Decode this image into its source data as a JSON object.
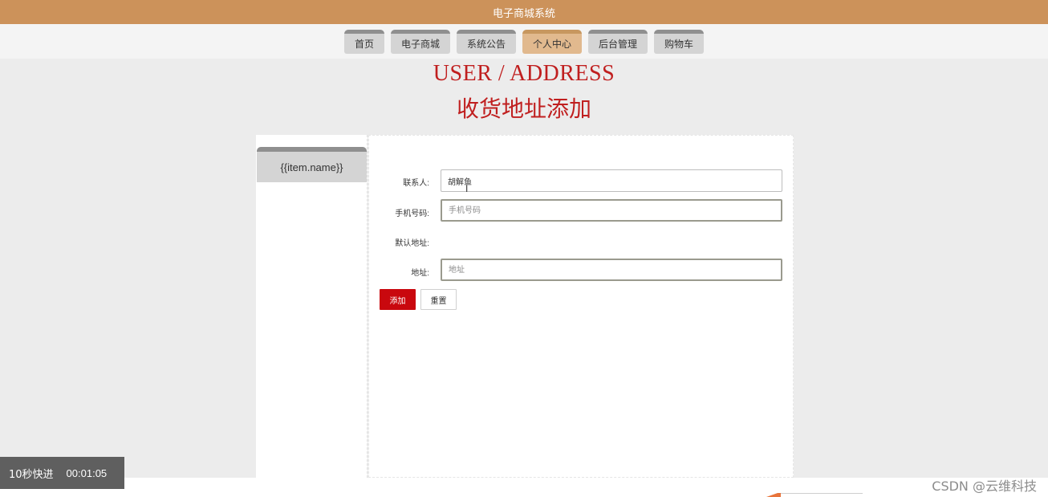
{
  "header": {
    "title": "电子商城系统"
  },
  "nav": {
    "items": [
      {
        "label": "首页"
      },
      {
        "label": "电子商城"
      },
      {
        "label": "系统公告"
      },
      {
        "label": "个人中心"
      },
      {
        "label": "后台管理"
      },
      {
        "label": "购物车"
      }
    ],
    "active_index": 3
  },
  "page": {
    "title_en": "USER / ADDRESS",
    "title_cn": "收货地址添加"
  },
  "sidebar": {
    "item_label": "{{item.name}}"
  },
  "form": {
    "contact_label": "联系人:",
    "contact_value": "胡解鱼",
    "phone_label": "手机号码:",
    "phone_placeholder": "手机号码",
    "default_label": "默认地址:",
    "address_label": "地址:",
    "address_placeholder": "地址",
    "add_button": "添加",
    "reset_button": "重置"
  },
  "overlay": {
    "label": "10秒快进",
    "time": "00:01:05"
  },
  "watermark": "CSDN @云维科技",
  "colors": {
    "topbar": "#cc925a",
    "nav_active": "#e1b98e",
    "title_red": "#c01f1f",
    "button_red": "#c9080e"
  }
}
